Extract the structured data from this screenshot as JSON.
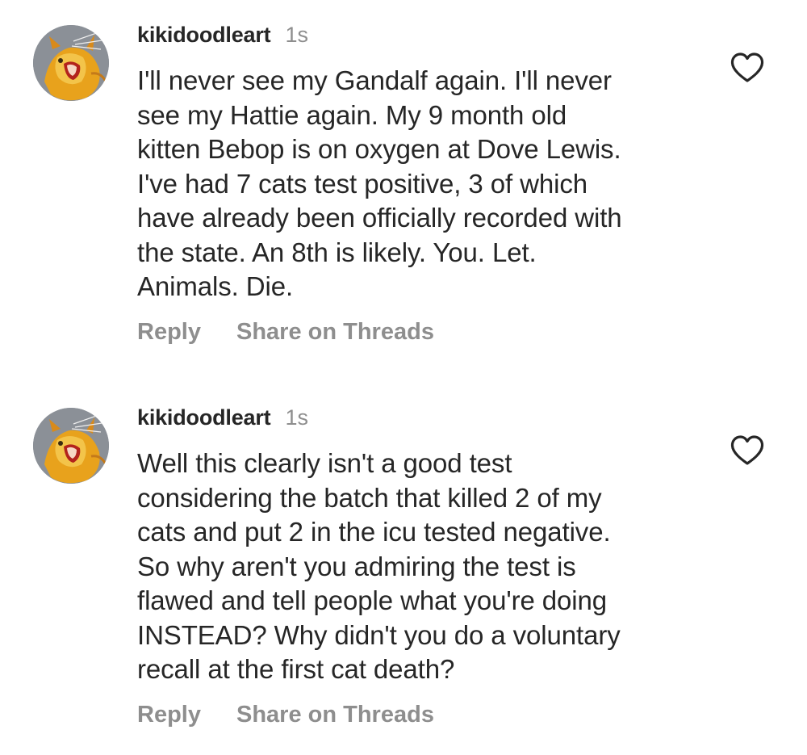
{
  "comments": [
    {
      "username": "kikidoodleart",
      "time": "1s",
      "text": "I'll never see my Gandalf again. I'll never\nsee my Hattie again. My 9 month old\nkitten Bebop is on oxygen at Dove Lewis.\nI've had 7 cats test positive, 3 of which\nhave already been officially recorded with\nthe state. An 8th is likely. You. Let.\nAnimals. Die.",
      "reply_label": "Reply",
      "share_label": "Share on Threads",
      "avatar_icon": "cat-illustration-avatar",
      "like_icon": "heart-outline-icon"
    },
    {
      "username": "kikidoodleart",
      "time": "1s",
      "text": "Well this clearly isn't a good test\nconsidering the batch that killed 2 of my\ncats and put 2 in the icu tested negative.\nSo why aren't you admiring the test is\nflawed and tell people what you're doing\nINSTEAD?  Why didn't you do a voluntary\nrecall at the first cat death?",
      "reply_label": "Reply",
      "share_label": "Share on Threads",
      "avatar_icon": "cat-illustration-avatar",
      "like_icon": "heart-outline-icon"
    }
  ],
  "colors": {
    "text_primary": "#262626",
    "text_secondary": "#8e8e8e",
    "background": "#ffffff"
  }
}
